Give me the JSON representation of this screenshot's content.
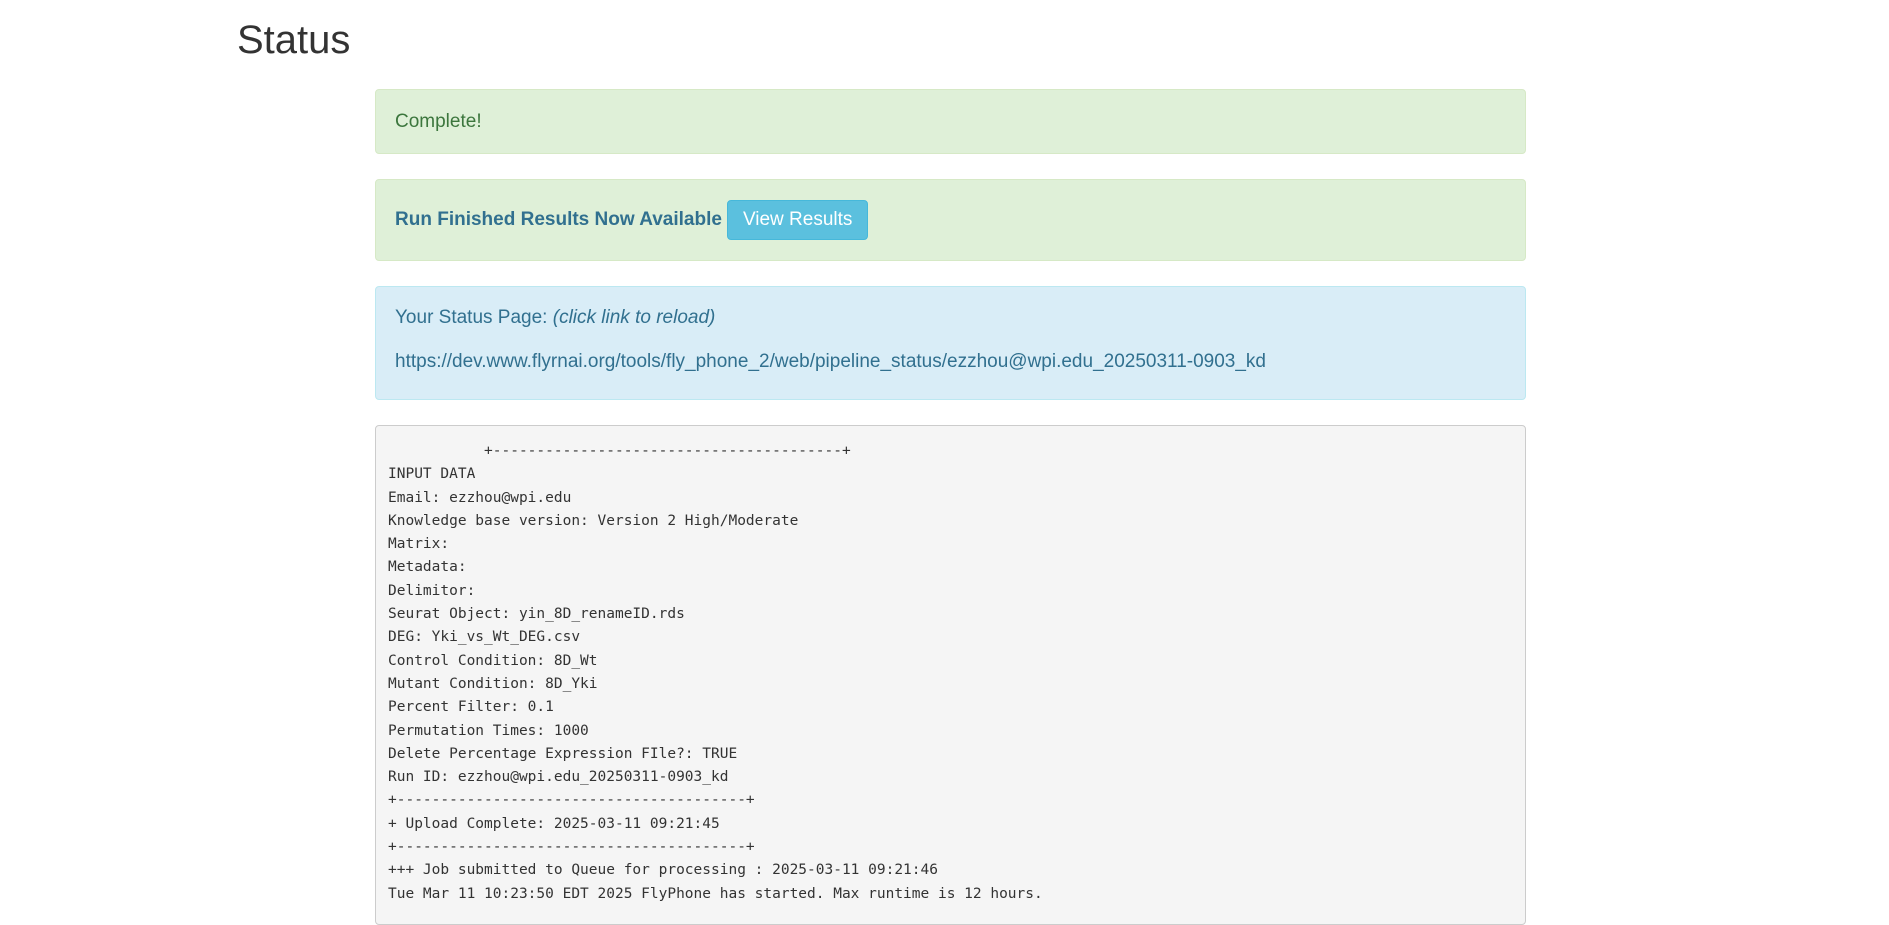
{
  "page": {
    "title": "Status"
  },
  "alerts": {
    "complete": "Complete!",
    "results_text": "Run Finished Results Now Available",
    "view_results_button": "View Results",
    "status_label": "Your Status Page:",
    "status_hint": "(click link to reload)",
    "status_url": "https://dev.www.flyrnai.org/tools/fly_phone_2/web/pipeline_status/ezzhou@wpi.edu_20250311-0903_kd"
  },
  "log": {
    "lines": [
      "           +----------------------------------------+",
      "INPUT DATA",
      "Email: ezzhou@wpi.edu",
      "Knowledge base version: Version 2 High/Moderate",
      "Matrix:",
      "Metadata:",
      "Delimitor:",
      "Seurat Object: yin_8D_renameID.rds",
      "DEG: Yki_vs_Wt_DEG.csv",
      "Control Condition: 8D_Wt",
      "Mutant Condition: 8D_Yki",
      "Percent Filter: 0.1",
      "Permutation Times: 1000",
      "Delete Percentage Expression FIle?: TRUE",
      "Run ID: ezzhou@wpi.edu_20250311-0903_kd",
      "+----------------------------------------+",
      "+ Upload Complete: 2025-03-11 09:21:45",
      "+----------------------------------------+",
      "+++ Job submitted to Queue for processing : 2025-03-11 09:21:46",
      "Tue Mar 11 10:23:50 EDT 2025 FlyPhone has started. Max runtime is 12 hours."
    ]
  },
  "colors": {
    "success_bg": "#dff0d8",
    "success_text": "#3c763d",
    "info_bg": "#d9edf7",
    "info_text": "#31708f",
    "button_bg": "#5bc0de"
  }
}
